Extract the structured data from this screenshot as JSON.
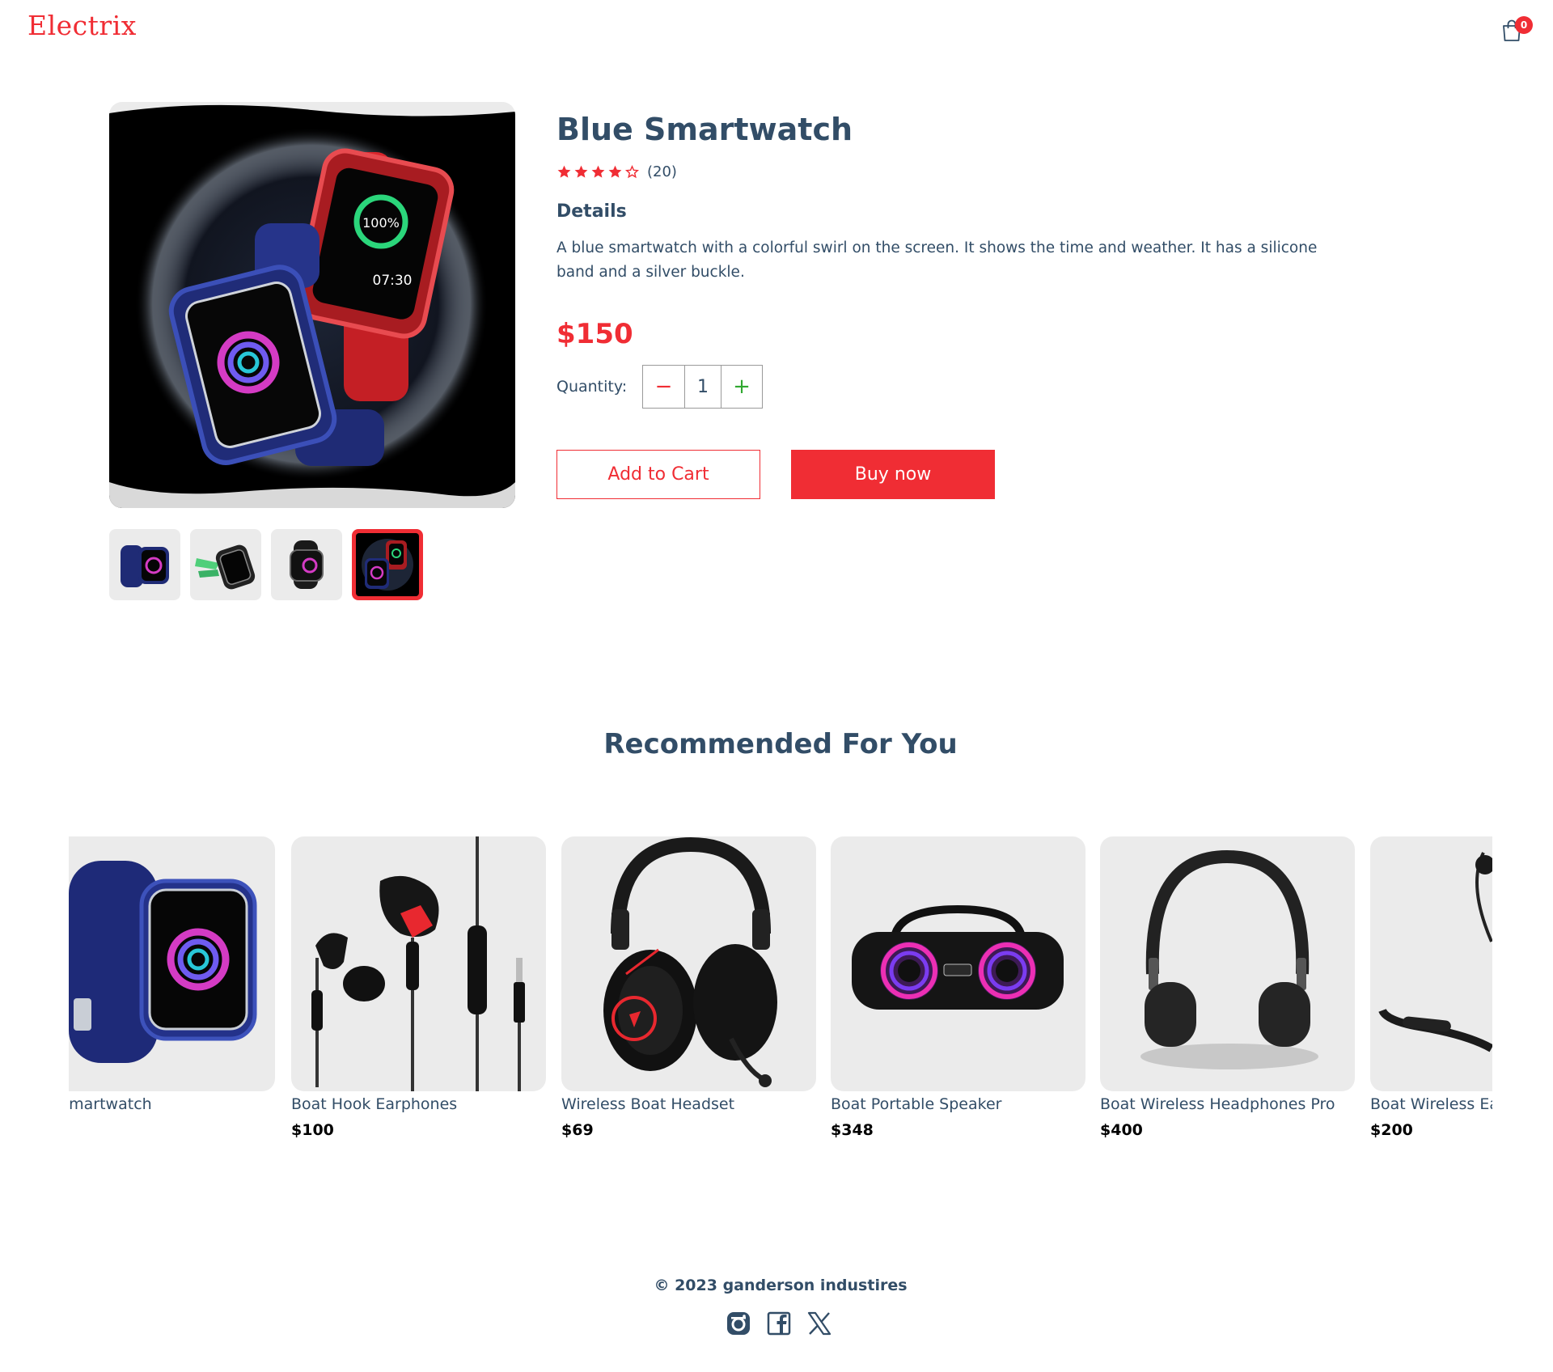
{
  "navbar": {
    "logo": "Electrix",
    "cart_count": "0"
  },
  "colors": {
    "accent": "#f02d34",
    "text": "#324d67",
    "image_bg": "#ebebeb",
    "plus": "#31a831"
  },
  "product": {
    "title": "Blue Smartwatch",
    "rating": 4,
    "rating_max": 5,
    "rating_count": "(20)",
    "details_heading": "Details",
    "description": "A blue smartwatch with a colorful swirl on the screen. It shows the time and weather. It has a silicone band and a silver buckle.",
    "price": "$150",
    "quantity_label": "Quantity:",
    "quantity_minus": "−",
    "quantity": "1",
    "quantity_plus": "+",
    "add_to_cart": "Add to Cart",
    "buy_now": "Buy now",
    "selected_thumbnail": 4
  },
  "recommended": {
    "heading": "Recommended For You",
    "items": [
      {
        "name": "Blue Smartwatch",
        "price": "",
        "icon": "smartwatch-image"
      },
      {
        "name": "Boat Hook Earphones",
        "price": "$100",
        "icon": "earphones-image"
      },
      {
        "name": "Wireless Boat Headset",
        "price": "$69",
        "icon": "headset-image"
      },
      {
        "name": "Boat Portable Speaker",
        "price": "$348",
        "icon": "speaker-image"
      },
      {
        "name": "Boat Wireless Headphones Pro",
        "price": "$400",
        "icon": "headphones-image"
      },
      {
        "name": "Boat Wireless Ear",
        "price": "$200",
        "icon": "neckband-image"
      }
    ]
  },
  "footer": {
    "copyright": "© 2023 ganderson industires",
    "social": [
      "instagram-icon",
      "facebook-icon",
      "x-icon"
    ]
  }
}
